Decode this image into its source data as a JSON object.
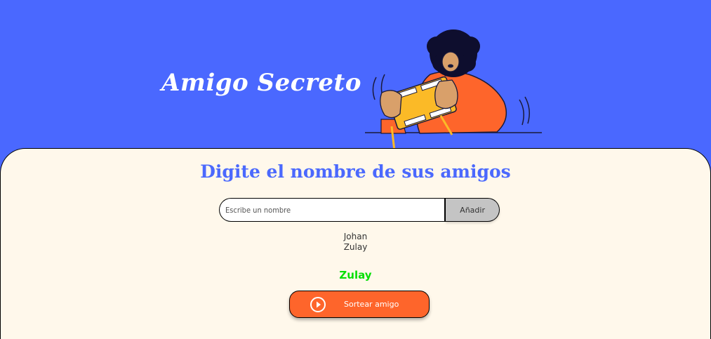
{
  "header": {
    "title": "Amigo Secreto"
  },
  "main": {
    "section_title": "Digite el nombre de sus amigos",
    "input": {
      "placeholder": "Escribe un nombre",
      "value": ""
    },
    "add_button_label": "Añadir",
    "friends": [
      "Johan",
      "Zulay"
    ],
    "result": "Zulay",
    "draw_button_label": "Sortear amigo",
    "draw_button_icon": "play-circle-icon"
  },
  "colors": {
    "header_bg": "#4A68FF",
    "panel_bg": "#FFF8EB",
    "title_blue": "#4B69FD",
    "add_button_bg": "#C4C4C4",
    "draw_button_bg": "#FE652B",
    "result_green": "#05DF05"
  }
}
